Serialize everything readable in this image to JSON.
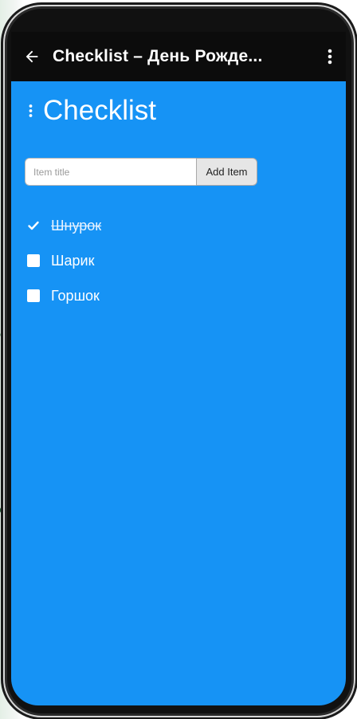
{
  "appbar": {
    "title": "Checklist – День Рожде..."
  },
  "page": {
    "heading": "Checklist"
  },
  "add_form": {
    "placeholder": "Item title",
    "button_label": "Add Item"
  },
  "items": [
    {
      "label": "Шнурок",
      "checked": true
    },
    {
      "label": "Шарик",
      "checked": false
    },
    {
      "label": "Горшок",
      "checked": false
    }
  ],
  "colors": {
    "appbar": "#0c0c0c",
    "background": "#1693f5",
    "text": "#ffffff"
  },
  "icons": [
    "arrow-back-icon",
    "more-vert-icon",
    "drag-handle-icon",
    "checkmark-icon"
  ]
}
